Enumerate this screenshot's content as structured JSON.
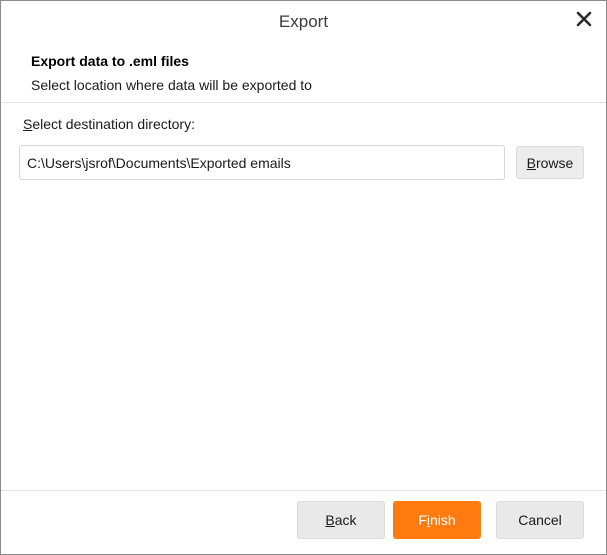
{
  "window": {
    "title": "Export"
  },
  "header": {
    "title": "Export data to .eml files",
    "subtitle": "Select location where data will be exported to"
  },
  "destination": {
    "label_accel": "S",
    "label_rest": "elect destination directory:",
    "path_value": "C:\\Users\\jsrof\\Documents\\Exported emails",
    "browse_accel": "B",
    "browse_rest": "rowse"
  },
  "footer": {
    "back_accel": "B",
    "back_rest": "ack",
    "finish_pre": "F",
    "finish_accel": "i",
    "finish_rest": "nish",
    "cancel_label": "Cancel"
  },
  "colors": {
    "accent": "#ff7a0f",
    "button_bg": "#e9e9e9"
  },
  "icons": {
    "close": "close-icon"
  }
}
